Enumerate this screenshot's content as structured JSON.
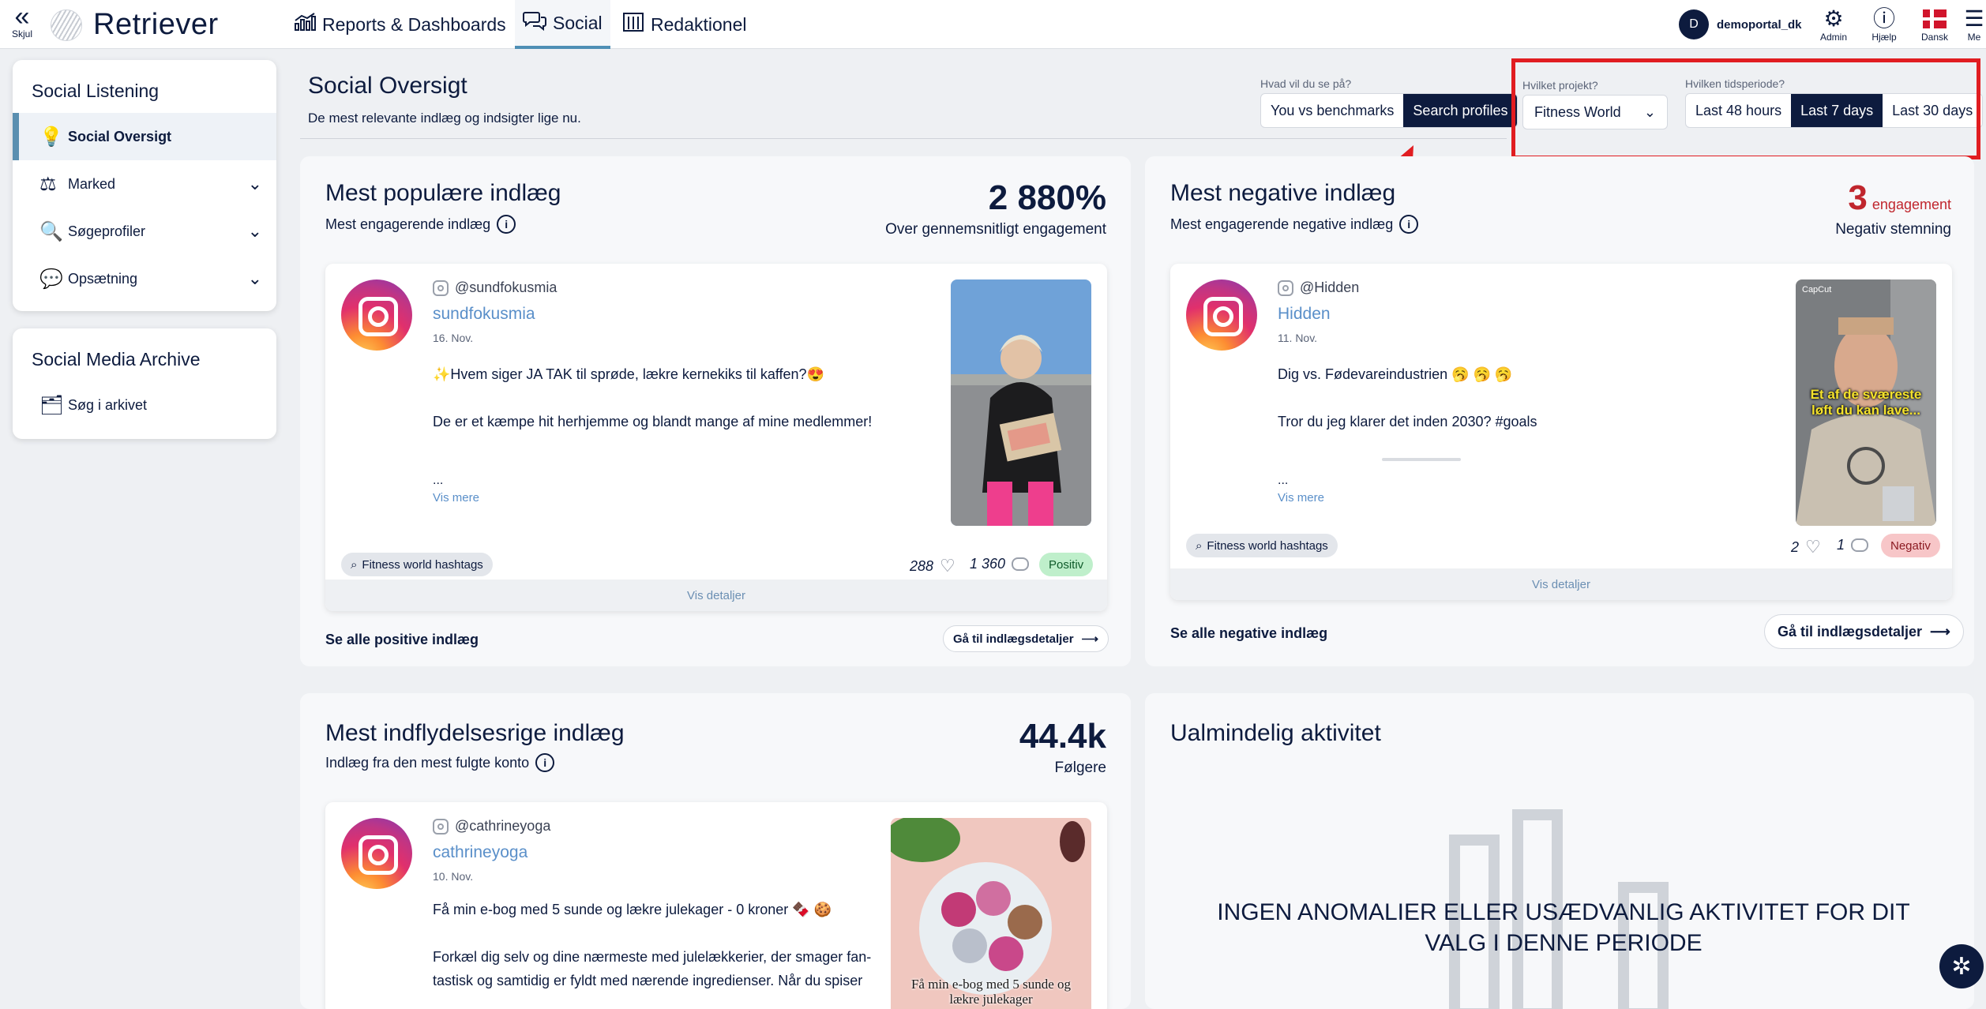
{
  "nav": {
    "hide_label": "Skjul",
    "brand": "Retriever",
    "tabs": [
      {
        "label": "Reports & Dashboards",
        "icon": "bar-chart-icon"
      },
      {
        "label": "Social",
        "icon": "chat-bubbles-icon"
      },
      {
        "label": "Redaktionel",
        "icon": "columns-icon"
      }
    ],
    "user": {
      "initial": "D",
      "name": "demoportal_dk"
    },
    "tools": [
      {
        "label": "Admin",
        "icon": "gear-icon"
      },
      {
        "label": "Hjælp",
        "icon": "info-icon"
      },
      {
        "label": "Dansk",
        "icon": "danish-flag-icon"
      },
      {
        "label": "Me",
        "icon": "menu-icon"
      }
    ]
  },
  "sidebar": {
    "listening_title": "Social Listening",
    "items": [
      {
        "label": "Social Oversigt",
        "icon": "lightbulb-icon",
        "active": true
      },
      {
        "label": "Marked",
        "icon": "scale-icon"
      },
      {
        "label": "Søgeprofiler",
        "icon": "magnifier-icon"
      },
      {
        "label": "Opsætning",
        "icon": "chat-icon"
      }
    ],
    "archive_title": "Social Media Archive",
    "archive_items": [
      {
        "label": "Søg i arkivet",
        "icon": "archive-search-icon"
      }
    ]
  },
  "header": {
    "title": "Social Oversigt",
    "subtitle": "De mest relevante indlæg og indsigter lige nu.",
    "view_label": "Hvad vil du se på?",
    "view_options": [
      "You vs benchmarks",
      "Search profiles"
    ],
    "view_selected": "Search profiles",
    "project_label": "Hvilket projekt?",
    "project_value": "Fitness World",
    "period_label": "Hvilken tidsperiode?",
    "period_options": [
      "Last 48 hours",
      "Last 7 days",
      "Last 30 days"
    ],
    "period_selected": "Last 7 days"
  },
  "popular": {
    "title": "Mest populære indlæg",
    "subtitle": "Mest engagerende indlæg",
    "big_number": "2 880%",
    "number_sub": "Over gennemsnitligt engagement",
    "post": {
      "handle": "@sundfokusmia",
      "name": "sundfokusmia",
      "date": "16. Nov.",
      "line1": "✨Hvem siger JA TAK til sprøde, lækre kernekiks til kaffen?😍",
      "line2": "De er et kæmpe hit herhjemme og blandt mange af mine medlemmer!",
      "ellipsis": "...",
      "more": "Vis mere",
      "tag": "Fitness world hashtags",
      "likes": "288",
      "comments": "1 360",
      "sentiment": "Positiv",
      "details": "Vis detaljer"
    },
    "see_all": "Se alle positive indlæg",
    "goto": "Gå til indlægsdetaljer"
  },
  "negative": {
    "title": "Mest negative indlæg",
    "subtitle": "Mest engagerende negative indlæg",
    "big_number": "3",
    "big_unit": "engagement",
    "number_sub": "Negativ stemning",
    "post": {
      "handle": "@Hidden",
      "name": "Hidden",
      "date": "11. Nov.",
      "line1": "Dig vs. Fødevareindustrien 🥱 🥱 🥱",
      "line2": "Tror du jeg klarer det inden 2030? #goals",
      "ellipsis": "...",
      "more": "Vis mere",
      "tag": "Fitness world hashtags",
      "likes": "2",
      "comments": "1",
      "sentiment": "Negativ",
      "details": "Vis detaljer",
      "thumb_caption": "Et af de sværeste løft du kan lave...",
      "thumb_watermark": "CapCut"
    },
    "see_all": "Se alle negative indlæg",
    "goto": "Gå til indlægsdetaljer"
  },
  "influential": {
    "title": "Mest indflydelsesrige indlæg",
    "subtitle": "Indlæg fra den mest fulgte konto",
    "big_number": "44.4k",
    "number_sub": "Følgere",
    "post": {
      "handle": "@cathrineyoga",
      "name": "cathrineyoga",
      "date": "10. Nov.",
      "line1": "Få min e-bog med 5 sunde og lækre julekager - 0 kroner 🍫 🍪",
      "line2a": "Forkæl dig selv og dine nærmeste med julelækkerier, der smager fan-",
      "line2b": "tastisk og samtidig er fyldt med nærende ingredienser. Når du spiser",
      "thumb_caption": "Få min e-bog med 5 sunde og lækre julekager"
    }
  },
  "unusual": {
    "title": "Ualmindelig aktivitet",
    "message": "INGEN ANOMALIER ELLER USÆDVANLIG AKTIVITET FOR DIT VALG I DENNE PERIODE"
  },
  "colors": {
    "navy": "#0d1b3e",
    "accent": "#5a8fb0",
    "annotation_red": "#e11d21",
    "negative_red": "#c0262d"
  }
}
